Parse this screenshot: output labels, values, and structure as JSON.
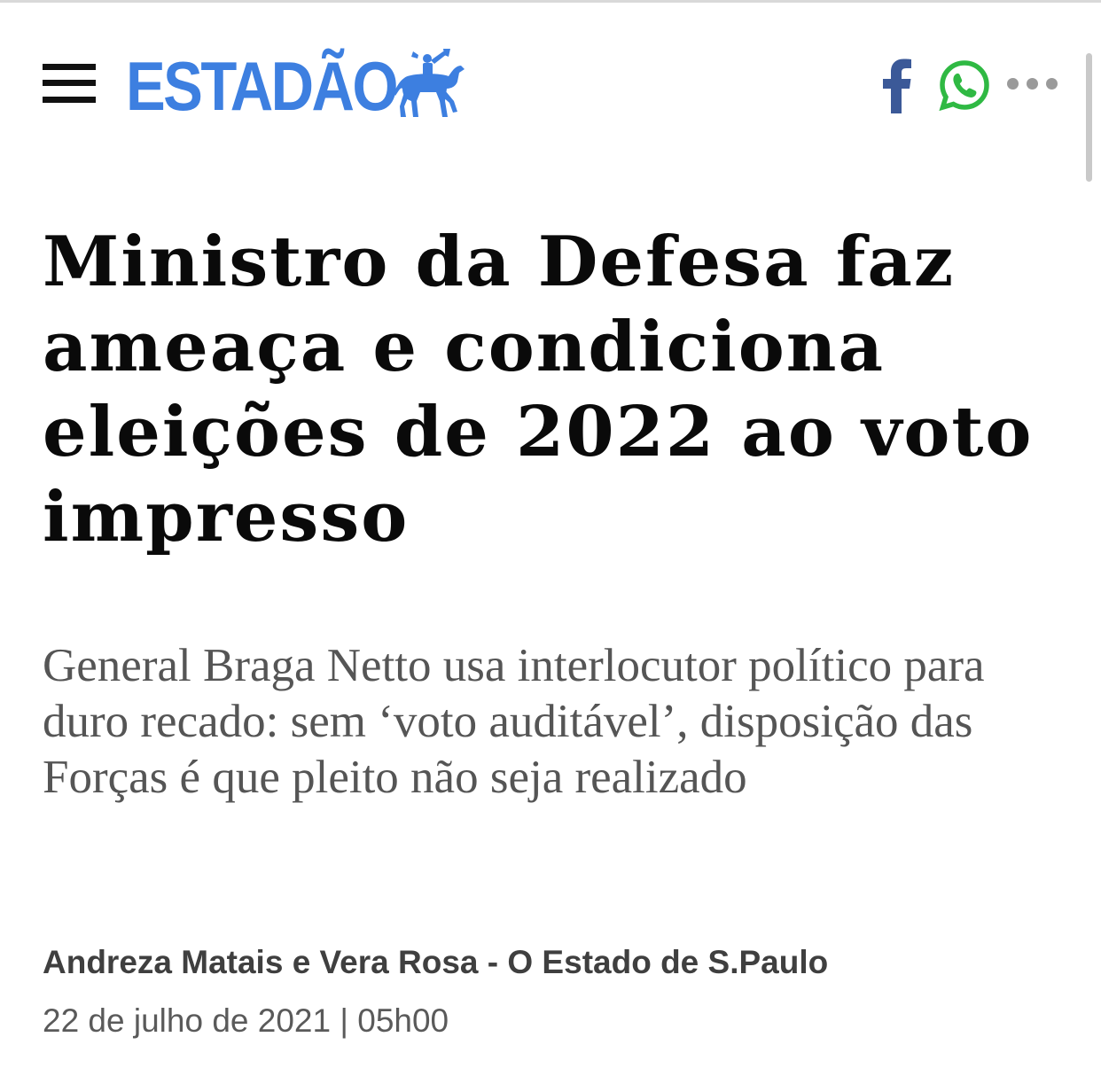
{
  "header": {
    "logo_text": "ESTADÃO",
    "brand_color": "#3d7fe0",
    "icons": [
      "menu-icon",
      "facebook-icon",
      "whatsapp-icon",
      "more-options-icon"
    ]
  },
  "article": {
    "headline": "Ministro da Defesa faz ameaça e condiciona eleições de 2022 ao voto impresso",
    "subtitle": "General Braga Netto usa interlocutor político para duro recado: sem ‘voto auditável’, disposição das Forças é que pleito não seja realizado",
    "byline": "Andreza Matais e Vera Rosa - O Estado de S.Paulo",
    "date": "22 de julho de 2021 | 05h00"
  },
  "colors": {
    "facebook": "#3b5998",
    "whatsapp": "#2fb943",
    "headline": "#0a0a0a",
    "subtitle": "#555555"
  }
}
